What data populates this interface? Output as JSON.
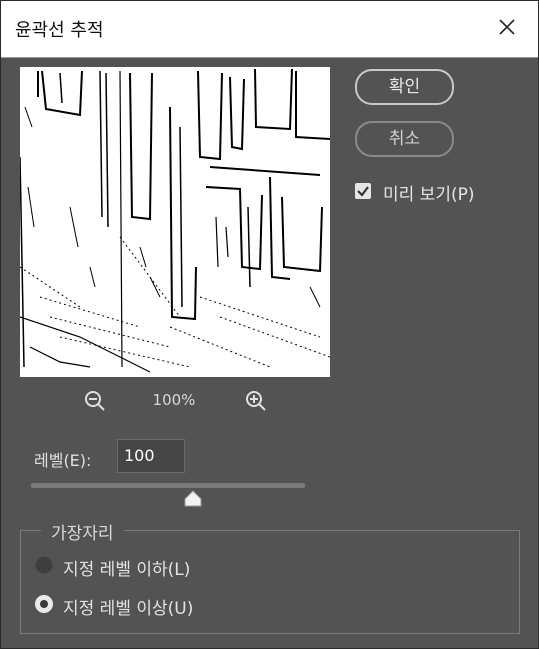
{
  "dialog": {
    "title": "윤곽선 추적",
    "close_icon": "close-icon"
  },
  "preview": {
    "zoom_level": "100%",
    "zoom_out_icon": "zoom-out-icon",
    "zoom_in_icon": "zoom-in-icon"
  },
  "buttons": {
    "ok_label": "확인",
    "cancel_label": "취소"
  },
  "preview_toggle": {
    "label": "미리 보기(P)",
    "checked": true
  },
  "level": {
    "label": "레벨(E):",
    "value": "100",
    "slider_fraction": 0.59
  },
  "edge": {
    "title": "가장자리",
    "options": [
      {
        "label": "지정 레벨 이하(L)",
        "selected": false
      },
      {
        "label": "지정 레벨 이상(U)",
        "selected": true
      }
    ]
  },
  "colors": {
    "panel": "#535353",
    "titlebar": "#ffffff",
    "text": "#e6e6e6"
  }
}
